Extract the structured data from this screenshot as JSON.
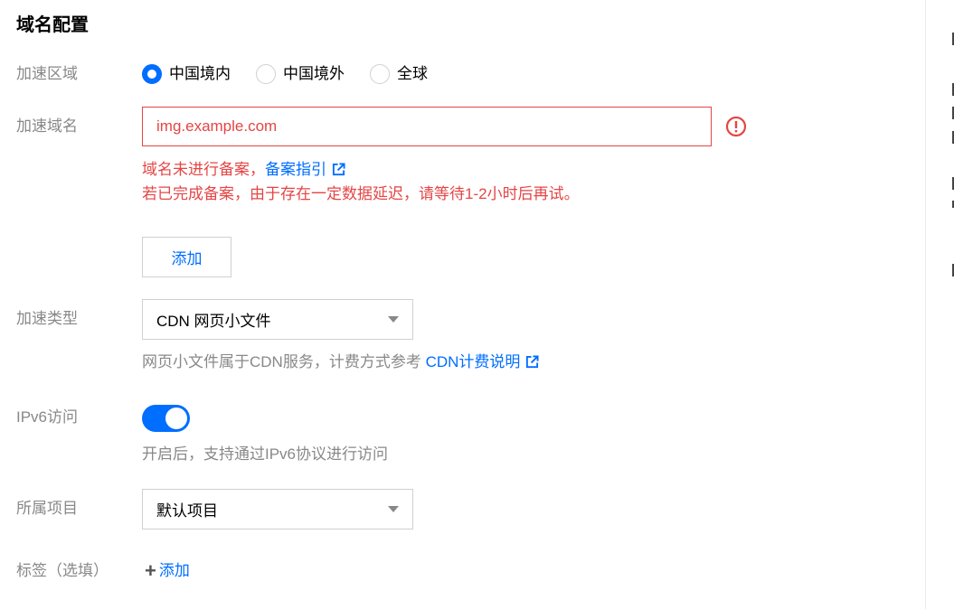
{
  "section": {
    "title": "域名配置"
  },
  "region": {
    "label": "加速区域",
    "options": [
      {
        "label": "中国境内",
        "checked": true
      },
      {
        "label": "中国境外",
        "checked": false
      },
      {
        "label": "全球",
        "checked": false
      }
    ]
  },
  "domain": {
    "label": "加速域名",
    "value": "img.example.com",
    "error_line1_prefix": "域名未进行备案，",
    "error_link": "备案指引",
    "error_line2": "若已完成备案，由于存在一定数据延迟，请等待1-2小时后再试。",
    "add_button": "添加"
  },
  "accel_type": {
    "label": "加速类型",
    "value": "CDN 网页小文件",
    "help_prefix": "网页小文件属于CDN服务，计费方式参考 ",
    "help_link": "CDN计费说明"
  },
  "ipv6": {
    "label": "IPv6访问",
    "enabled": true,
    "help": "开启后，支持通过IPv6协议进行访问"
  },
  "project": {
    "label": "所属项目",
    "value": "默认项目"
  },
  "tags": {
    "label": "标签（选填）",
    "add_label": "添加"
  },
  "colors": {
    "accent": "#006eff",
    "error": "#e54545",
    "muted": "#888888"
  }
}
